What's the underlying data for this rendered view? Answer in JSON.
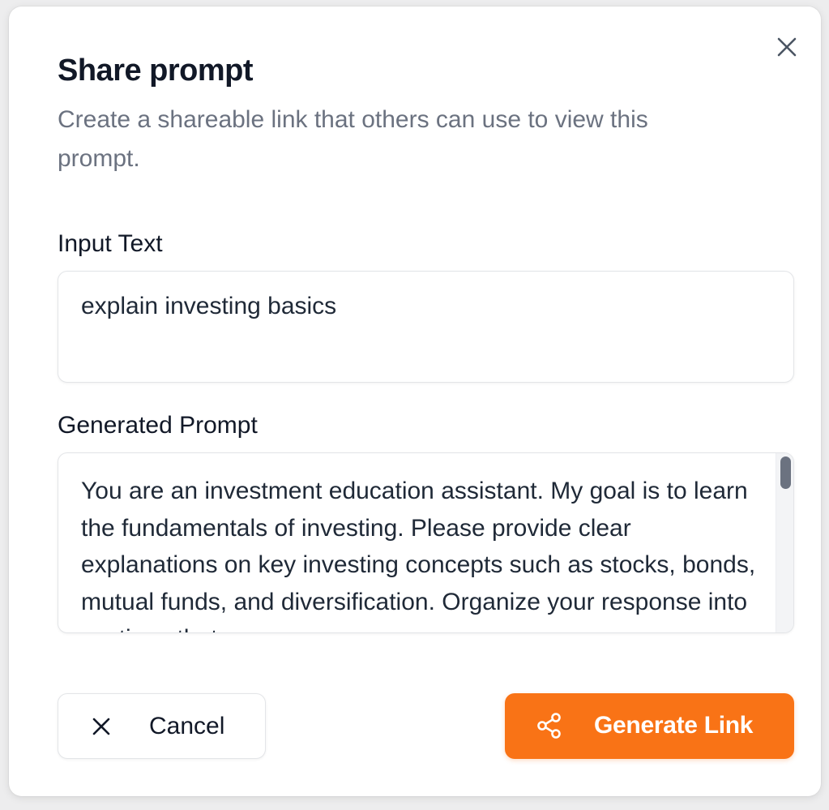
{
  "dialog": {
    "title": "Share prompt",
    "subtitle": "Create a shareable link that others can use to view this prompt.",
    "close_icon": "close-icon"
  },
  "input": {
    "label": "Input Text",
    "value": "explain investing basics"
  },
  "generated": {
    "label": "Generated Prompt",
    "value": "You are an investment education assistant. My goal is to learn the fundamentals of investing. Please provide clear explanations on key investing concepts such as stocks, bonds, mutual funds, and diversification. Organize your response into sections that cover"
  },
  "actions": {
    "cancel_label": "Cancel",
    "cancel_icon": "close-icon",
    "generate_label": "Generate Link",
    "generate_icon": "share-icon"
  },
  "colors": {
    "accent": "#f97316",
    "title": "#111827",
    "subtitle": "#6b7280",
    "border": "#e3e5e8"
  }
}
